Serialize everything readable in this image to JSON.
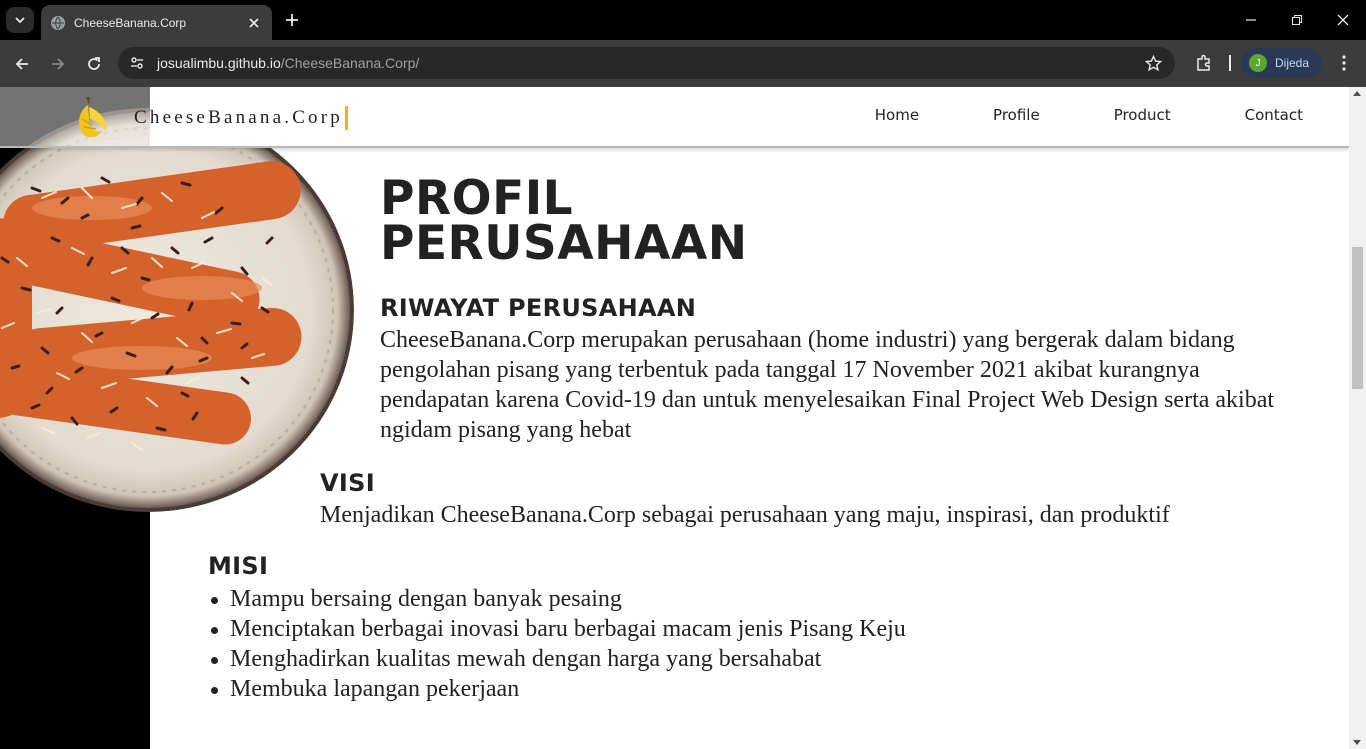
{
  "browser": {
    "tab_title": "CheeseBanana.Corp",
    "url_host": "josualimbu.github.io",
    "url_path": "/CheeseBanana.Corp/",
    "profile_initial": "J",
    "profile_name": "Dijeda"
  },
  "site": {
    "brand": "CheeseBanana.Corp",
    "accent_color": "#f2b01e",
    "nav": [
      "Home",
      "Profile",
      "Product",
      "Contact"
    ]
  },
  "profile": {
    "title_line1": "PROFIL",
    "title_line2": "PERUSAHAAN",
    "history_heading": "RIWAYAT PERUSAHAAN",
    "history_text": "CheeseBanana.Corp merupakan perusahaan (home industri) yang bergerak dalam bidang pengolahan pisang yang terbentuk pada tanggal 17 November 2021 akibat kurangnya pendapatan karena Covid-19 dan untuk menyelesaikan Final Project Web Design serta akibat ngidam pisang yang hebat",
    "vision_heading": "VISI",
    "vision_text": "Menjadikan CheeseBanana.Corp sebagai perusahaan yang maju, inspirasi, dan produktif",
    "mission_heading": "MISI",
    "mission_items": [
      "Mampu bersaing dengan banyak pesaing",
      "Menciptakan berbagai inovasi baru berbagai macam jenis Pisang Keju",
      "Menghadirkan kualitas mewah dengan harga yang bersahabat",
      "Membuka lapangan pekerjaan"
    ]
  }
}
